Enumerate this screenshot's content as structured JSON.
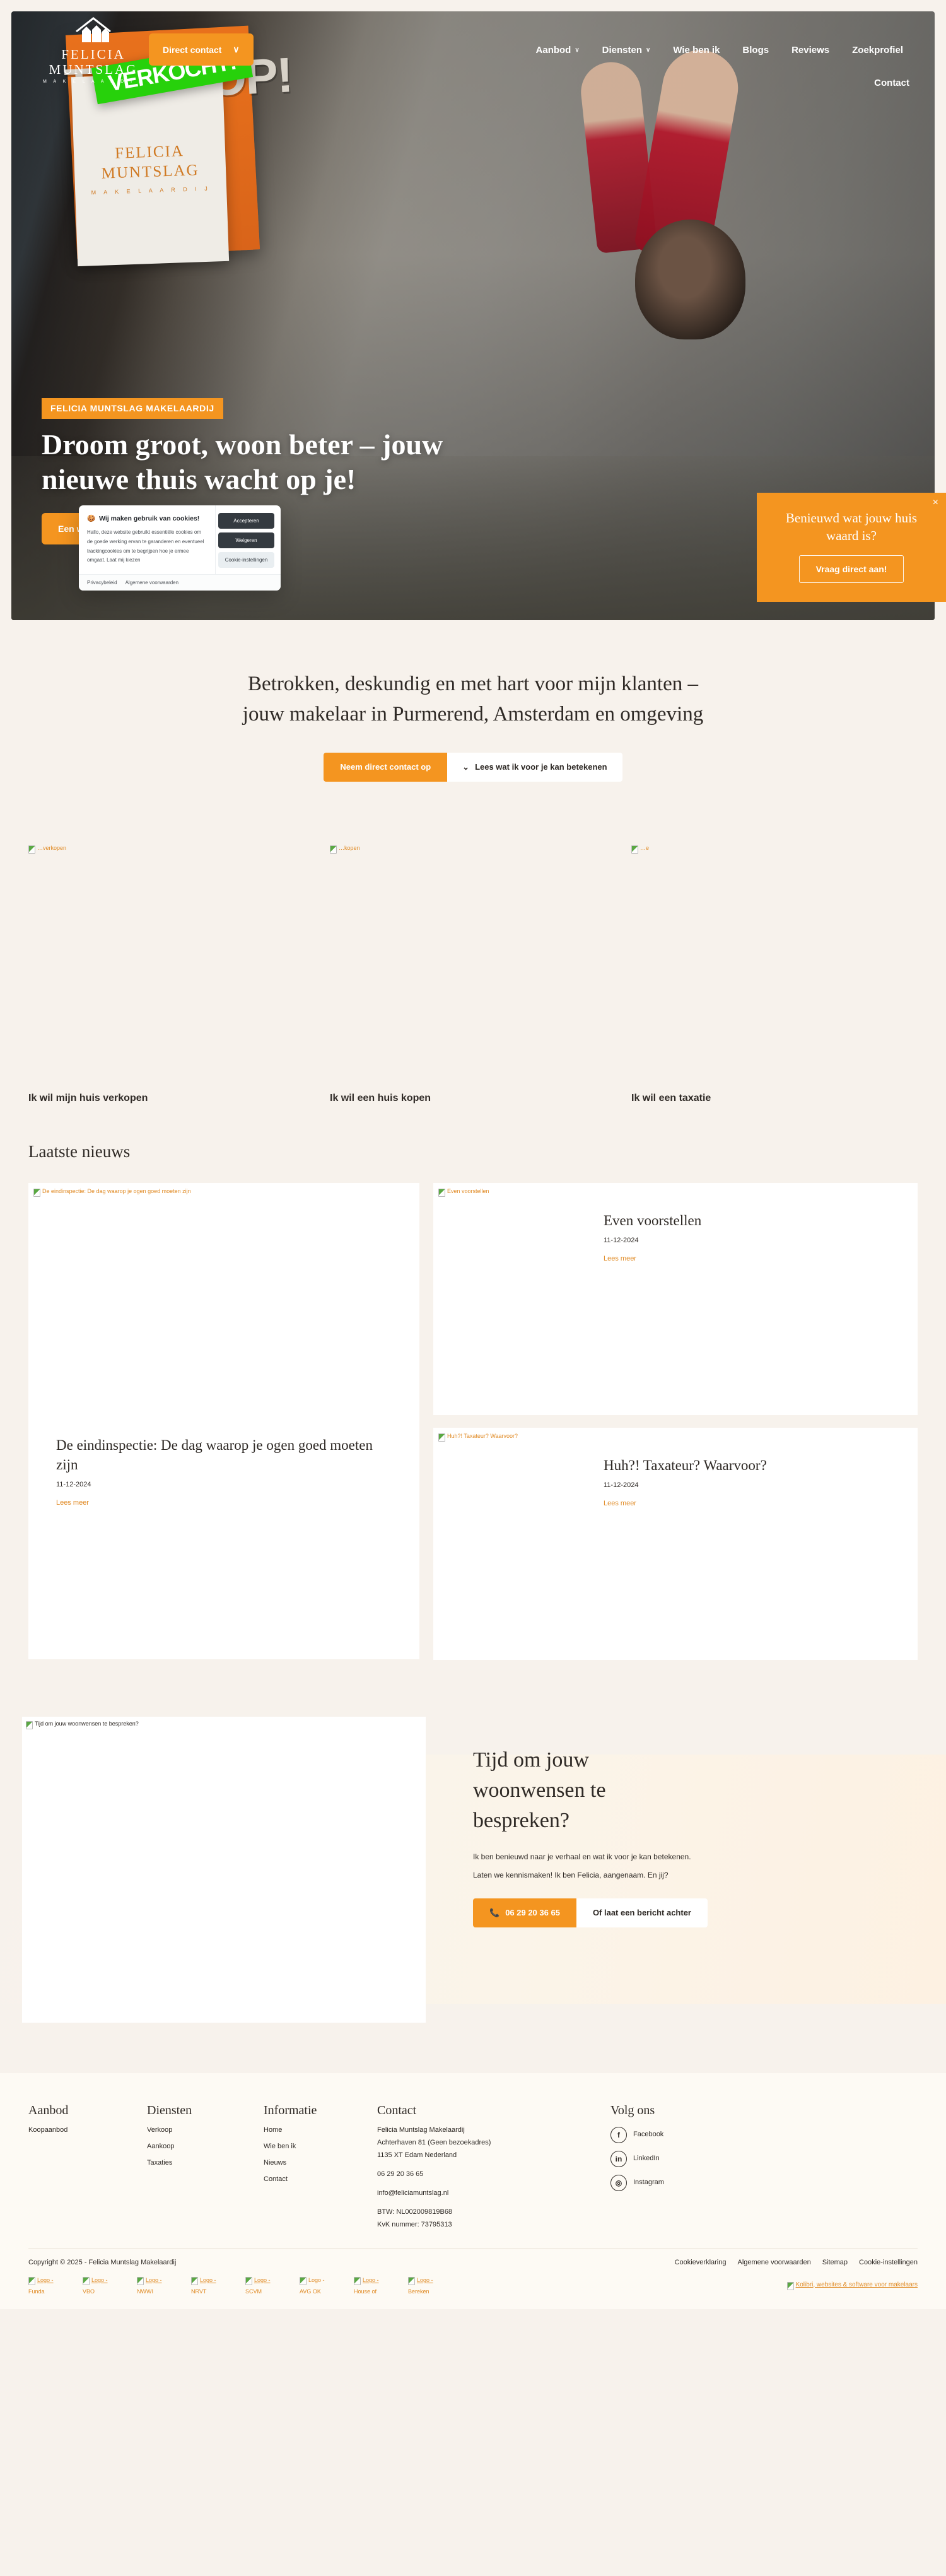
{
  "brand": {
    "name_line1": "FELICIA",
    "name_line2": "MUNTSLAG",
    "tagline": "M A K E L A A R D I J"
  },
  "nav": {
    "items": [
      {
        "label": "Aanbod",
        "caret": "∨"
      },
      {
        "label": "Diensten",
        "caret": "∨"
      },
      {
        "label": "Wie ben ik",
        "caret": ""
      },
      {
        "label": "Blogs",
        "caret": ""
      },
      {
        "label": "Reviews",
        "caret": ""
      },
      {
        "label": "Zoekprofiel",
        "caret": ""
      }
    ],
    "contact": "Contact",
    "direct_contact": "Direct contact",
    "direct_contact_caret": "∨"
  },
  "hero": {
    "badge": "FELICIA MUNTSLAG MAKELAARDIJ",
    "title": "Droom groot, woon beter – jouw nieuwe thuis wacht op je!",
    "cta": "Een woning aankopen",
    "sign_text": "TE KOOP!",
    "sign_sold": "VERKOCHT!",
    "sign_name_line1": "FELICIA",
    "sign_name_line2": "MUNTSLAG",
    "sign_sub": "M A K E L A A R D I J"
  },
  "value_widget": {
    "title": "Benieuwd wat jouw huis waard is?",
    "button": "Vraag direct aan!",
    "close": "×"
  },
  "cookie": {
    "icon": "🍪",
    "title": "Wij maken gebruik van cookies!",
    "body": "Hallo, deze website gebruikt essentiële cookies om de goede werking ervan te garanderen en eventueel trackingcookies om te begrijpen hoe je ermee omgaat. Laat mij kiezen",
    "accept": "Accepteren",
    "decline": "Weigeren",
    "settings": "Cookie-instellingen",
    "privacy": "Privacybeleid",
    "terms": "Algemene voorwaarden"
  },
  "intro": {
    "heading": "Betrokken, deskundig en met hart voor mijn klanten – jouw makelaar in Purmerend, Amsterdam en omgeving",
    "primary_button": "Neem direct contact op",
    "ghost_button": "Lees wat ik voor je kan betekenen",
    "ghost_icon": "⌄"
  },
  "services": [
    {
      "alt": "…verkopen",
      "title": "Ik wil mijn huis verkopen"
    },
    {
      "alt": "…kopen",
      "title": "Ik wil een huis kopen"
    },
    {
      "alt": "…e",
      "title": "Ik wil een taxatie"
    }
  ],
  "news": {
    "heading": "Laatste nieuws",
    "read_more": "Lees meer",
    "featured": {
      "alt": "De eindinspectie: De dag waarop je ogen goed moeten zijn",
      "title": "De eindinspectie: De dag waarop je ogen goed moeten zijn",
      "date": "11-12-2024",
      "read_more": "Lees meer"
    },
    "items": [
      {
        "alt": "Even voorstellen",
        "title": "Even voorstellen",
        "date": "11-12-2024",
        "read_more": "Lees meer"
      },
      {
        "alt": "Huh?! Taxateur? Waarvoor?",
        "title": "Huh?! Taxateur? Waarvoor?",
        "date": "11-12-2024",
        "read_more": "Lees meer"
      }
    ]
  },
  "cta": {
    "image_alt": "Tijd om jouw woonwensen te bespreken?",
    "heading": "Tijd om jouw woonwensen te bespreken?",
    "paragraph1": "Ik ben benieuwd naar je verhaal en wat ik voor je kan betekenen.",
    "paragraph2": "Laten we kennismaken! Ik ben Felicia, aangenaam. En jij?",
    "phone_icon": "📞",
    "phone": "06 29 20 36 65",
    "message_button": "Of laat een bericht achter"
  },
  "footer": {
    "col_aanbod": {
      "title": "Aanbod",
      "links": [
        "Koopaanbod"
      ]
    },
    "col_diensten": {
      "title": "Diensten",
      "links": [
        "Verkoop",
        "Aankoop",
        "Taxaties"
      ]
    },
    "col_informatie": {
      "title": "Informatie",
      "links": [
        "Home",
        "Wie ben ik",
        "Nieuws",
        "Contact"
      ]
    },
    "col_contact": {
      "title": "Contact",
      "company": "Felicia Muntslag Makelaardij",
      "address1": "Achterhaven 81 (Geen bezoekadres)",
      "address2": "1135 XT Edam Nederland",
      "phone": "06 29 20 36 65",
      "email": "info@feliciamuntslag.nl",
      "btw_label": "BTW:",
      "btw_value": "NL002009819B68",
      "kvk": "KvK nummer: 73795313"
    },
    "col_social": {
      "title": "Volg ons",
      "items": [
        {
          "label": "Facebook",
          "glyph": "f"
        },
        {
          "label": "LinkedIn",
          "glyph": "in"
        },
        {
          "label": "Instagram",
          "glyph": "◎"
        }
      ]
    },
    "copyright": "Copyright © 2025 - Felicia Muntslag Makelaardij",
    "legal_links": [
      "Cookieverklaring",
      "Algemene voorwaarden",
      "Sitemap",
      "Cookie-instellingen"
    ],
    "partner_logos": [
      {
        "alt": "Logo -",
        "name": "Funda"
      },
      {
        "alt": "Logo -",
        "name": "VBO"
      },
      {
        "alt": "Logo -",
        "name": "NWWI"
      },
      {
        "alt": "Logo -",
        "name": "NRVT"
      },
      {
        "alt": "Logo -",
        "name": "SCVM"
      },
      {
        "alt": "Logo -",
        "name": "AVG OK"
      },
      {
        "alt": "Logo -",
        "name": "House of"
      },
      {
        "alt": "Logo -",
        "name": "Bereken"
      }
    ],
    "attribution": "Kolibri, websites & software voor makelaars"
  },
  "colors": {
    "accent": "#f49520",
    "accent_text": "#e08a24",
    "page_bg": "#f7f2ec",
    "dark": "#343a40",
    "text": "#2f2a26"
  }
}
